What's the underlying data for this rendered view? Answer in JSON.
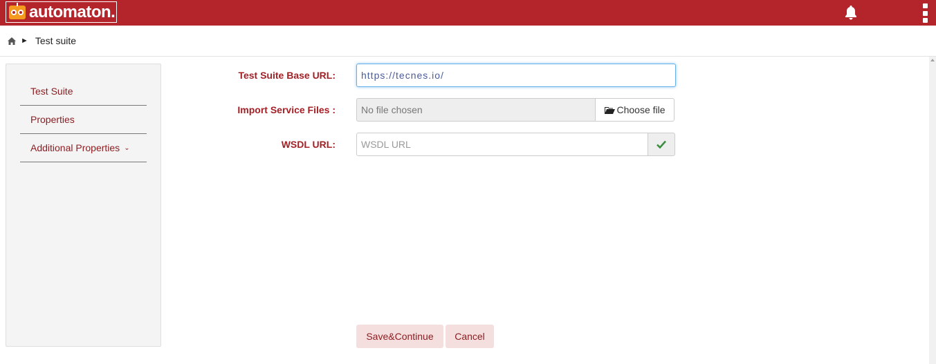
{
  "header": {
    "logo_text": "automaton.",
    "brand_color": "#b3252b",
    "icons": [
      "automaton-logo-icon",
      "bell-icon",
      "kebab-menu-icon"
    ]
  },
  "breadcrumb": {
    "home_icon": "home-icon",
    "separator": "►",
    "current": "Test suite"
  },
  "sidebar": {
    "items": [
      {
        "label": "Test Suite"
      },
      {
        "label": "Properties"
      },
      {
        "label": "Additional Properties",
        "chevron": "⌄"
      }
    ]
  },
  "form": {
    "base_url_label": "Test Suite Base URL:",
    "base_url_value": "https://tecnes.io/",
    "import_label": "Import Service Files :",
    "file_status": "No file chosen",
    "choose_file_label": "Choose file",
    "wsdl_label": "WSDL URL:",
    "wsdl_placeholder": "WSDL URL"
  },
  "actions": {
    "save_label": "Save&Continue",
    "cancel_label": "Cancel"
  }
}
